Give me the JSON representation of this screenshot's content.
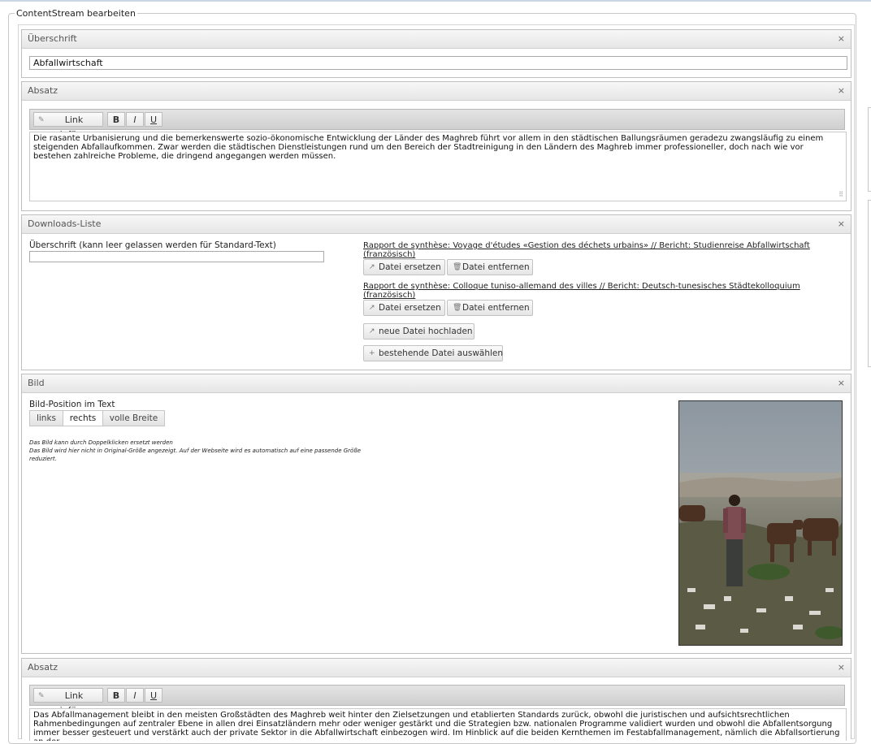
{
  "window": {
    "legend": "ContentStream bearbeiten"
  },
  "heading_panel": {
    "title": "Überschrift",
    "close": "×",
    "value": "Abfallwirtschaft"
  },
  "paragraph1": {
    "title": "Absatz",
    "close": "×",
    "toolbar": {
      "link_label": "Link einfügen",
      "bold": "B",
      "italic": "I",
      "underline": "U"
    },
    "text": "Die rasante Urbanisierung und die bemerkenswerte sozio-ökonomische Entwicklung der Länder des Maghreb führt vor allem in den städtischen Ballungsräumen geradezu zwangsläufig zu einem steigenden Abfallaufkommen. Zwar werden die städtischen Dienstleistungen rund um den Bereich der Stadtreinigung in den Ländern des Maghreb immer professioneller, doch nach wie vor bestehen zahlreiche Probleme, die dringend angegangen werden müssen."
  },
  "downloads": {
    "title": "Downloads-Liste",
    "close": "×",
    "heading_label": "Überschrift (kann leer gelassen werden für Standard-Text)",
    "heading_value": "",
    "files": [
      {
        "name": "Rapport de synthèse: Voyage d'études «Gestion des déchets urbains» // Bericht: Studienreise Abfallwirtschaft (französisch)"
      },
      {
        "name": "Rapport de synthèse: Colloque tuniso-allemand des villes // Bericht: Deutsch-tunesisches Städtekolloquium (französisch)"
      }
    ],
    "replace_label": "Datei ersetzen",
    "remove_label": "Datei entfernen",
    "upload_label": "neue Datei hochladen",
    "select_label": "bestehende Datei auswählen"
  },
  "image_panel": {
    "title": "Bild",
    "close": "×",
    "position_label": "Bild-Position im Text",
    "positions": [
      "links",
      "rechts",
      "volle Breite"
    ],
    "active_position": "rechts",
    "note_line1": "Das Bild kann durch Doppelklicken ersetzt werden",
    "note_line2": "Das Bild wird hier nicht in Original-Größe angezeigt. Auf der Webseite wird es automatisch auf eine passende Größe reduziert."
  },
  "paragraph2": {
    "title": "Absatz",
    "close": "×",
    "toolbar": {
      "link_label": "Link einfügen",
      "bold": "B",
      "italic": "I",
      "underline": "U"
    },
    "text": "Das Abfallmanagement bleibt in den meisten Großstädten des Maghreb weit hinter den Zielsetzungen und etablierten Standards zurück, obwohl die juristischen und aufsichtsrechtlichen Rahmenbedingungen auf zentraler Ebene in allen drei Einsatzländern mehr oder weniger gestärkt und die Strategien bzw. nationalen Programme validiert wurden und obwohl die Abfallentsorgung immer besser gesteuert und verstärkt auch der private Sektor in die Abfallwirtschaft einbezogen wird. Im Hinblick auf die beiden Kernthemen im Festabfallmanagement, nämlich die Abfallsortierung an der"
  },
  "colors": {
    "panel_border": "#bfbfbf",
    "header_bg": "#e6e6e6",
    "toolbar_bg": "#cfcfcf"
  }
}
